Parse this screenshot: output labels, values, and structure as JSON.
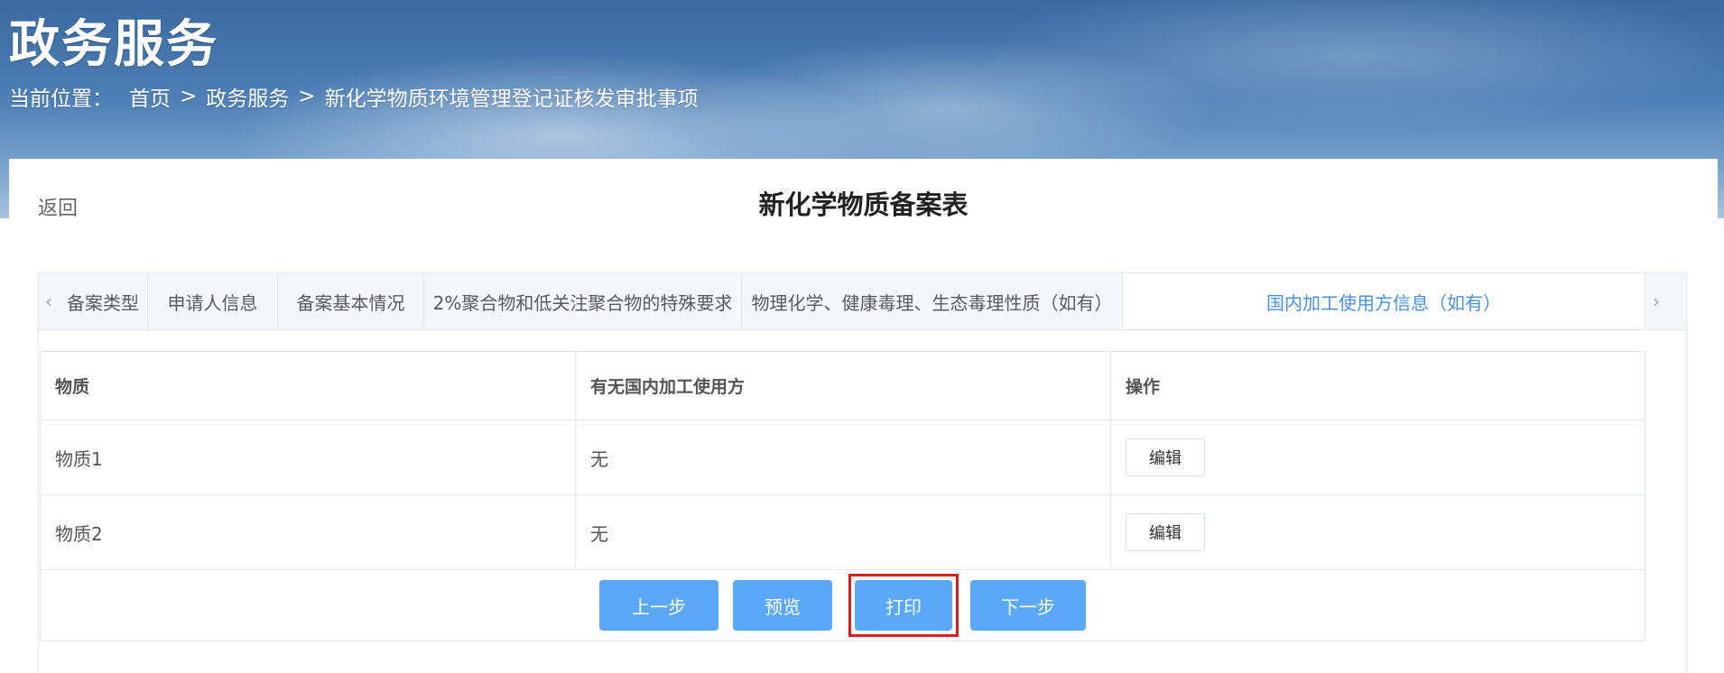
{
  "header": {
    "title": "政务服务",
    "breadcrumb_label": "当前位置：",
    "breadcrumbs": [
      "首页",
      "政务服务",
      "新化学物质环境管理登记证核发审批事项"
    ],
    "separator": ">"
  },
  "page": {
    "back_label": "返回",
    "form_title": "新化学物质备案表"
  },
  "tabs": {
    "prev_arrow": "‹",
    "next_arrow": "›",
    "items": [
      {
        "label": "备案类型"
      },
      {
        "label": "申请人信息"
      },
      {
        "label": "备案基本情况"
      },
      {
        "label": "2%聚合物和低关注聚合物的特殊要求"
      },
      {
        "label": "物理化学、健康毒理、生态毒理性质（如有）"
      },
      {
        "label": "国内加工使用方信息（如有）"
      }
    ],
    "active_index": 5
  },
  "table": {
    "columns": [
      "物质",
      "有无国内加工使用方",
      "操作"
    ],
    "rows": [
      {
        "substance": "物质1",
        "has_domestic_user": "无",
        "action_label": "编辑"
      },
      {
        "substance": "物质2",
        "has_domestic_user": "无",
        "action_label": "编辑"
      }
    ]
  },
  "actions": {
    "prev_label": "上一步",
    "preview_label": "预览",
    "print_label": "打印",
    "next_label": "下一步"
  },
  "colors": {
    "accent": "#5ca8f8",
    "active_tab_text": "#4a90e2",
    "highlight_border": "#d81e1e"
  }
}
